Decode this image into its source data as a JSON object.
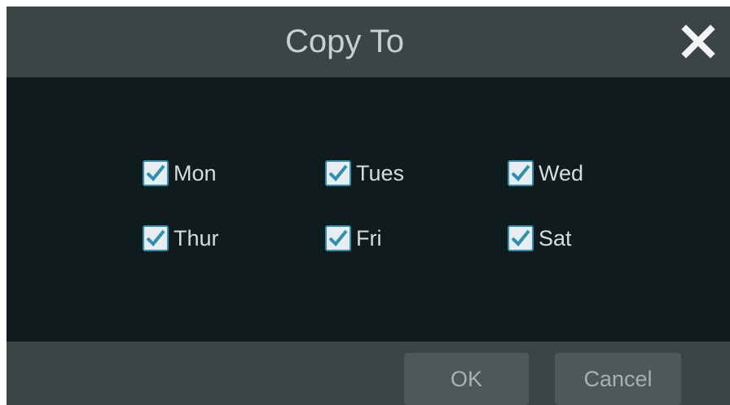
{
  "dialog": {
    "title": "Copy To",
    "close_icon": "close-icon"
  },
  "days": [
    {
      "label": "Mon",
      "checked": true
    },
    {
      "label": "Tues",
      "checked": true
    },
    {
      "label": "Wed",
      "checked": true
    },
    {
      "label": "Thur",
      "checked": true
    },
    {
      "label": "Fri",
      "checked": true
    },
    {
      "label": "Sat",
      "checked": true
    }
  ],
  "buttons": {
    "ok_label": "OK",
    "cancel_label": "Cancel"
  },
  "colors": {
    "title_bar": "#3b4546",
    "content_bg": "#0f1b1d",
    "checkbox_accent": "#2f8fb0",
    "button_bg": "#4e5859"
  }
}
